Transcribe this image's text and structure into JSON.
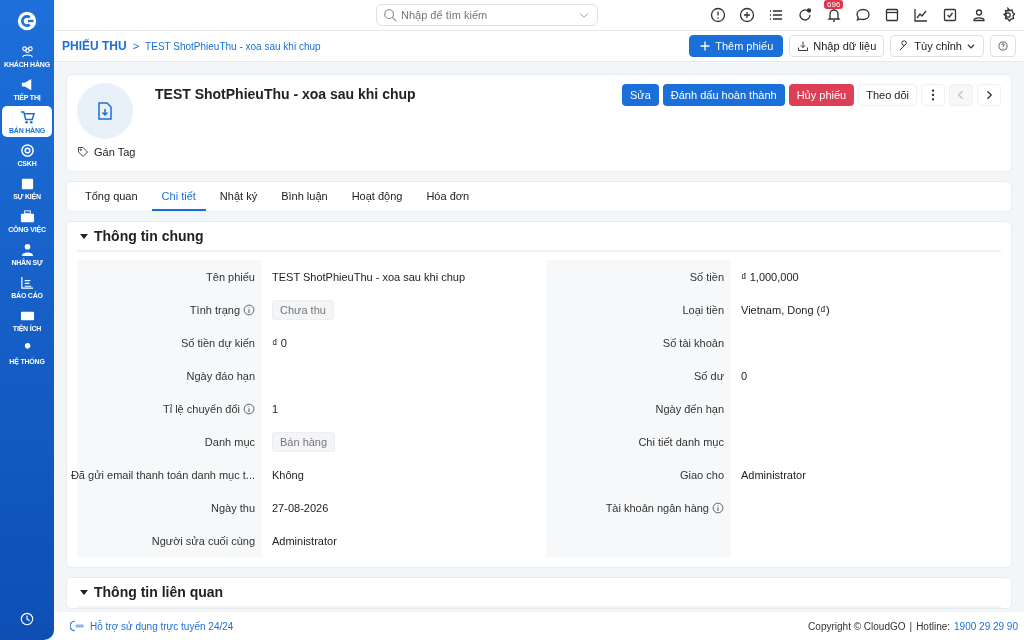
{
  "sidebar": {
    "items": [
      {
        "label": "KHÁCH HÀNG",
        "selected": false
      },
      {
        "label": "TIẾP THỊ",
        "selected": false
      },
      {
        "label": "BÁN HÀNG",
        "selected": true
      },
      {
        "label": "CSKH",
        "selected": false
      },
      {
        "label": "SỰ KIỆN",
        "selected": false
      },
      {
        "label": "CÔNG VIỆC",
        "selected": false
      },
      {
        "label": "NHÂN SỰ",
        "selected": false
      },
      {
        "label": "BÁO CÁO",
        "selected": false
      },
      {
        "label": "TIỆN ÍCH",
        "selected": false
      },
      {
        "label": "HỆ THỐNG",
        "selected": false
      }
    ]
  },
  "topbar": {
    "search": {
      "placeholder": "Nhập để tìm kiếm"
    },
    "notification_count": "696"
  },
  "breadcrumb": {
    "module": "PHIẾU THU",
    "separator": ">",
    "record": "TEST ShotPhieuThu - xoa sau khi chup"
  },
  "toolbar": {
    "add": "Thêm phiếu",
    "import": "Nhập dữ liệu",
    "customize": "Tùy chỉnh"
  },
  "record": {
    "title": "TEST ShotPhieuThu - xoa sau khi chup",
    "tag_label": "Gán Tag",
    "actions": [
      {
        "label": "Sửa",
        "kind": "primary"
      },
      {
        "label": "Đánh dấu hoàn thành",
        "kind": "primary"
      },
      {
        "label": "Hủy phiếu",
        "kind": "danger"
      },
      {
        "label": "Theo dõi",
        "kind": "plain"
      }
    ],
    "prev_disabled": true,
    "next_disabled": false
  },
  "tabs": [
    {
      "label": "Tổng quan",
      "selected": false
    },
    {
      "label": "Chi tiết",
      "selected": true
    },
    {
      "label": "Nhật ký",
      "selected": false
    },
    {
      "label": "Bình luận",
      "selected": false
    },
    {
      "label": "Hoạt động",
      "selected": false
    },
    {
      "label": "Hóa đơn",
      "selected": false
    }
  ],
  "sections": [
    {
      "title": "Thông tin chung",
      "expanded": true,
      "left": [
        {
          "label": "Tên phiếu",
          "value": "TEST ShotPhieuThu - xoa sau khi chup",
          "kind": "text",
          "info": false
        },
        {
          "label": "Tình trạng",
          "value": "Chưa thu",
          "kind": "tag",
          "info": true
        },
        {
          "label": "Số tiền dự kiến",
          "value": "₫ 0",
          "kind": "text",
          "info": false
        },
        {
          "label": "Ngày đáo hạn",
          "info": false
        },
        {
          "label": "Tỉ lệ chuyển đổi",
          "value": "1",
          "kind": "text",
          "info": true
        },
        {
          "label": "Danh mục",
          "value": "Bán hàng",
          "kind": "tag",
          "info": false
        },
        {
          "label": "Đã gửi email thanh toán danh mục t...",
          "value": "Không",
          "kind": "text",
          "info": false
        },
        {
          "label": "Ngày thu",
          "value": "27-08-2026",
          "kind": "text",
          "info": false
        },
        {
          "label": "Người sửa cuối cùng",
          "value": "Administrator",
          "kind": "text",
          "info": false
        }
      ],
      "right": [
        {
          "label": "Số tiền",
          "value": "₫ 1,000,000",
          "kind": "text",
          "info": false
        },
        {
          "label": "Loại tiền",
          "value": "Vietnam, Dong (₫)",
          "kind": "text",
          "info": false
        },
        {
          "label": "Số tài khoản",
          "info": false
        },
        {
          "label": "Số dư",
          "value": "0",
          "kind": "text",
          "info": false
        },
        {
          "label": "Ngày đến hạn",
          "info": false
        },
        {
          "label": "Chi tiết danh mục",
          "info": false
        },
        {
          "label": "Giao cho",
          "value": "Administrator",
          "kind": "text",
          "info": false
        },
        {
          "label": "Tài khoản ngân hàng",
          "info": true
        }
      ]
    },
    {
      "title": "Thông tin liên quan",
      "expanded": true
    }
  ],
  "footer": {
    "support": "Hỗ trợ sử dụng trực tuyến 24/24",
    "copyright": "Copyright © CloudGO",
    "separator": "|",
    "hotline_label": "Hotline:",
    "hotline": "1900 29 29 90"
  }
}
